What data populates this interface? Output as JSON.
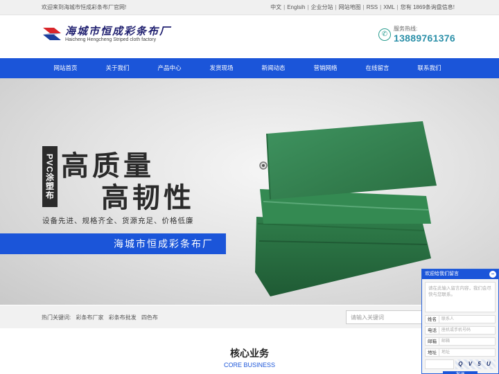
{
  "topbar": {
    "welcome": "欢迎来到海城市恒成彩条布厂官网!",
    "links": [
      "中文",
      "Englsih",
      "企业分站",
      "网站地图",
      "RSS",
      "XML",
      "您有 1869条询盘信息!"
    ]
  },
  "header": {
    "logo_cn": "海城市恒成彩条布厂",
    "logo_en": "Haicheng Hengcheng Striped cloth factory",
    "hotline_label": "服务热线:",
    "hotline_number": "13889761376"
  },
  "nav": {
    "items": [
      "网站首页",
      "关于我们",
      "产品中心",
      "发货现场",
      "新闻动态",
      "营销网络",
      "在线留言",
      "联系我们"
    ]
  },
  "banner": {
    "vertical_tag": "PVC涂塑布",
    "headline_1": "高质量",
    "headline_2": "高韧性",
    "slogan": "设备先进、规格齐全、货源充足、价格低廉",
    "band_text": "海城市恒成彩条布厂"
  },
  "keywords": {
    "label": "热门关键词:",
    "items": [
      "彩条布厂家",
      "彩条布批发",
      "四色布"
    ],
    "search_placeholder": "请输入关键词"
  },
  "core": {
    "title": "核心业务",
    "subtitle": "CORE BUSINESS"
  },
  "message_widget": {
    "title": "欢迎给我们留言",
    "minimize": "−",
    "textarea_placeholder": "请在此输入留言内容，我们会尽快与您联系。",
    "fields": [
      {
        "label": "姓名",
        "placeholder": "联系人"
      },
      {
        "label": "电话",
        "placeholder": "座机或手机号码"
      },
      {
        "label": "邮箱",
        "placeholder": "邮箱"
      },
      {
        "label": "地址",
        "placeholder": "地址"
      }
    ],
    "captcha_text": "Q V 5 U",
    "send_label": "发送"
  },
  "colors": {
    "brand_blue": "#1b55d9",
    "hotline_teal": "#2a8fa8",
    "tarp_green": "#2f7d4a"
  }
}
